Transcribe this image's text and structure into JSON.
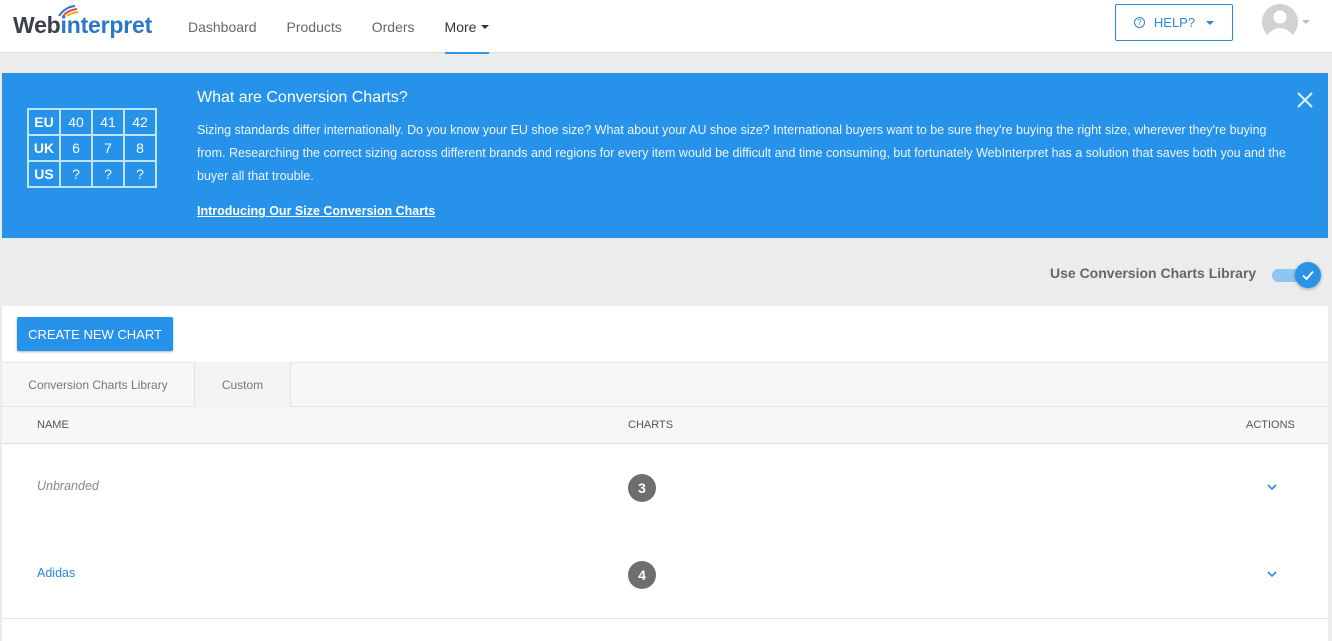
{
  "brand": {
    "logo_part1": "Web",
    "logo_part2": "interpret"
  },
  "nav": {
    "items": [
      "Dashboard",
      "Products",
      "Orders",
      "More"
    ]
  },
  "header": {
    "help_label": "HELP?"
  },
  "banner": {
    "size_table": [
      [
        "EU",
        "40",
        "41",
        "42"
      ],
      [
        "UK",
        "6",
        "7",
        "8"
      ],
      [
        "US",
        "?",
        "?",
        "?"
      ]
    ],
    "title": "What are Conversion Charts?",
    "text": "Sizing standards differ internationally. Do you know your EU shoe size? What about your AU shoe size? International buyers want to be sure they're buying the right size, wherever they're buying from. Researching the correct sizing across different brands and regions for every item would be difficult and time consuming, but fortunately WebInterpret has a solution that saves both you and the buyer all that trouble.",
    "link": "Introducing Our Size Conversion Charts"
  },
  "toggle": {
    "label": "Use Conversion Charts Library",
    "checked": true
  },
  "toolbar": {
    "create_label": "CREATE NEW CHART"
  },
  "tabs": [
    "Conversion Charts Library",
    "Custom"
  ],
  "table": {
    "columns": [
      "NAME",
      "CHARTS",
      "ACTIONS"
    ],
    "rows": [
      {
        "name": "Unbranded",
        "charts": "3"
      },
      {
        "name": "Adidas",
        "charts": "4"
      }
    ]
  },
  "colors": {
    "accent": "#2792ea",
    "link": "#2a89d8",
    "badge": "#6e6e6e"
  }
}
